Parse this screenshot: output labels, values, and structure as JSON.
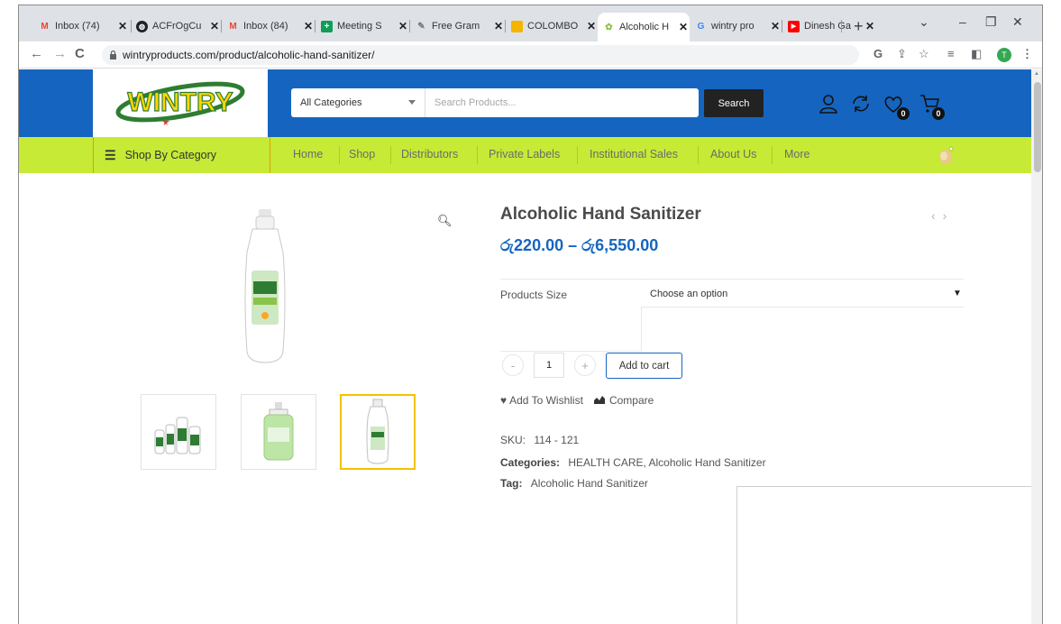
{
  "browser": {
    "tabs": [
      {
        "title": "Inbox (74)",
        "icon": "gmail-icon"
      },
      {
        "title": "ACFrOgCu",
        "icon": "globe-icon"
      },
      {
        "title": "Inbox (84)",
        "icon": "gmail-icon"
      },
      {
        "title": "Meeting S",
        "icon": "sheets-icon"
      },
      {
        "title": "Free Gram",
        "icon": "pen-icon"
      },
      {
        "title": "COLOMBO",
        "icon": "folder-icon"
      },
      {
        "title": "Alcoholic H",
        "icon": "wintry-icon",
        "active": true
      },
      {
        "title": "wintry pro",
        "icon": "google-icon"
      },
      {
        "title": "Dinesh Ga",
        "icon": "youtube-icon"
      }
    ],
    "url": "wintryproducts.com/product/alcoholic-hand-sanitizer/",
    "profile_initial": "T"
  },
  "site": {
    "logo_text": "WINTRY",
    "category_select": "All Categories",
    "search_placeholder": "Search Products...",
    "search_button": "Search",
    "wishlist_count": "0",
    "cart_count": "0",
    "nav": {
      "shop_by_category": "Shop By Category",
      "items": [
        "Home",
        "Shop",
        "Distributors",
        "Private Labels",
        "Institutional Sales",
        "About Us",
        "More"
      ]
    }
  },
  "product": {
    "title": "Alcoholic Hand Sanitizer",
    "price": "රු220.00 – රු6,550.00",
    "option_label": "Products Size",
    "option_placeholder": "Choose an option",
    "quantity": "1",
    "add_to_cart": "Add to cart",
    "wishlist": "Add To Wishlist",
    "compare": "Compare",
    "sku_label": "SKU:",
    "sku": "114 - 121",
    "categories_label": "Categories:",
    "categories": "HEALTH CARE, Alcoholic Hand Sanitizer",
    "tag_label": "Tag:",
    "tag": "Alcoholic Hand Sanitizer"
  },
  "colors": {
    "header_blue": "#1565c0",
    "nav_green": "#c6ea36",
    "thumb_active": "#f2c200"
  }
}
